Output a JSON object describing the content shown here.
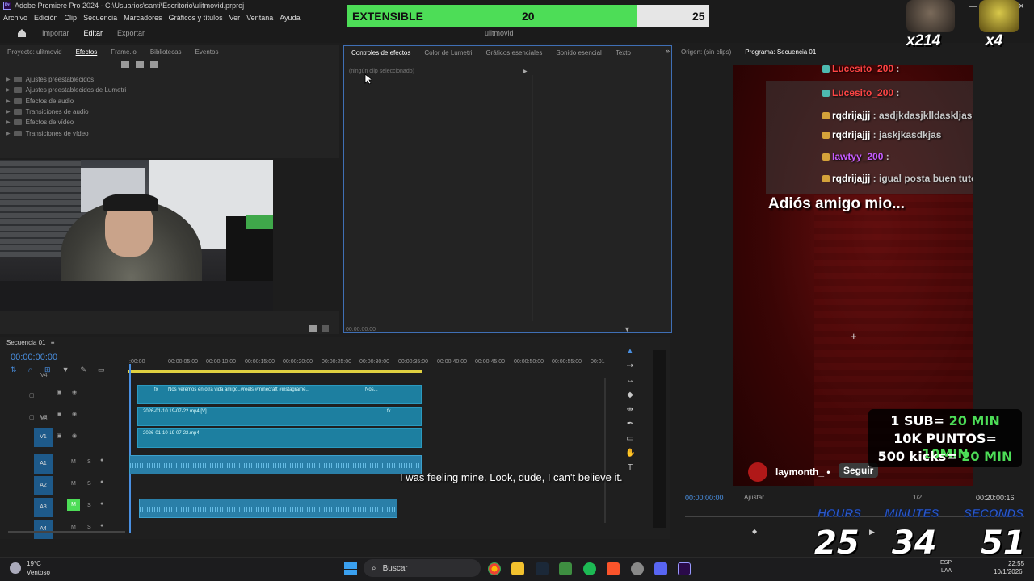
{
  "window": {
    "title": "Adobe Premiere Pro 2024 - C:\\Usuarios\\santi\\Escritorio\\ulitmovid.prproj",
    "file_title": "ulitmovid"
  },
  "menubar": [
    "Archivo",
    "Edición",
    "Clip",
    "Secuencia",
    "Marcadores",
    "Gráficos y títulos",
    "Ver",
    "Ventana",
    "Ayuda"
  ],
  "workspaces": {
    "importar": "Importar",
    "editar": "Editar",
    "exportar": "Exportar"
  },
  "project_panel": {
    "tabs": [
      "Proyecto: ulitmovid",
      "Efectos",
      "Frame.io",
      "Bibliotecas",
      "Eventos"
    ],
    "active_tab": "Efectos",
    "items": [
      "Ajustes preestablecidos",
      "Ajustes preestablecidos de Lumetri",
      "Efectos de audio",
      "Transiciones de audio",
      "Efectos de vídeo",
      "Transiciones de vídeo"
    ]
  },
  "effect_controls": {
    "tabs": [
      "Controles de efectos",
      "Color de Lumetri",
      "Gráficos esenciales",
      "Sonido esencial",
      "Texto"
    ],
    "empty_msg": "(ningún clip seleccionado)",
    "timecode": "00:00:00:00"
  },
  "monitors": {
    "source_tab": "Origen: (sin clips)",
    "program_tab": "Programa: Secuencia 01",
    "program_timecode": "00:00:00:00",
    "fit": "Ajustar",
    "resolution": "1/2",
    "duration": "00:20:00:16"
  },
  "overlay_goal": {
    "label": "EXTENSIBLE",
    "current": "20",
    "target": "25",
    "progress": 0.8,
    "fill_color": "#4ddd57"
  },
  "stream_badges": {
    "left": "x214",
    "right": "x4"
  },
  "chat": [
    {
      "user": "Lucesito_200",
      "msg": "",
      "color": "#ff4545"
    },
    {
      "user": "Lucesito_200",
      "msg": "",
      "color": "#ff4545"
    },
    {
      "user": "rqdrijajjj",
      "msg": "asdjkdasjklldaskljaslkj",
      "color": "#ffffff"
    },
    {
      "user": "rqdrijajjj",
      "msg": "jaskjkasdkjas",
      "color": "#ffffff"
    },
    {
      "user": "lawtyy_200",
      "msg": "",
      "color": "#c65cff"
    },
    {
      "user": "rqdrijajjj",
      "msg": "igual posta buen tutorial",
      "color": "#ffffff"
    }
  ],
  "stream_text": {
    "adios": "Adiós amigo mio...",
    "follow_user": "laymonth_",
    "follow_sep": "•",
    "follow_btn": "Seguir"
  },
  "promo": [
    {
      "pre": "1 SUB= ",
      "hl": "20 MIN"
    },
    {
      "pre": "10K PUNTOS= ",
      "hl": "10MIN"
    },
    {
      "pre": "500 kicks= ",
      "hl": "20 MIN"
    }
  ],
  "timer": {
    "hours_label": "HOURS",
    "minutes_label": "MINUTES",
    "seconds_label": "SECONDS",
    "hours": "25",
    "minutes": "34",
    "seconds": "51"
  },
  "subtitle": "I was feeling mine. Look, dude, I can't believe it.",
  "timeline": {
    "sequence_tab": "Secuencia 01",
    "timecode": "00:00:00:00",
    "ruler": [
      ":00:00",
      "00:00:05:00",
      "00:00:10:00",
      "00:00:15:00",
      "00:00:20:00",
      "00:00:25:00",
      "00:00:30:00",
      "00:00:35:00",
      "00:00:40:00",
      "00:00:45:00",
      "00:00:50:00",
      "00:00:55:00",
      "00:01"
    ],
    "tracks_video": [
      "V4",
      "V3",
      "V2",
      "V1"
    ],
    "tracks_audio": [
      "A1",
      "A2",
      "A3",
      "A4"
    ],
    "clip_v3": "Nos veremos en otra vida amigo..#reels #minecraft #instagrame...",
    "clip_v3_b": "Nos...",
    "clip_v2": "2026-01-10 19-07-22.mp4 [V]",
    "clip_v1": "2026-01-10 19-07-22.mp4",
    "fx": "fx",
    "m": "M",
    "s": "S"
  },
  "taskbar": {
    "weather_temp": "19°C",
    "weather_desc": "Ventoso",
    "search": "Buscar",
    "lang": "ESP",
    "lang2": "LAA",
    "time": "22:55",
    "date": "10/1/2026"
  }
}
